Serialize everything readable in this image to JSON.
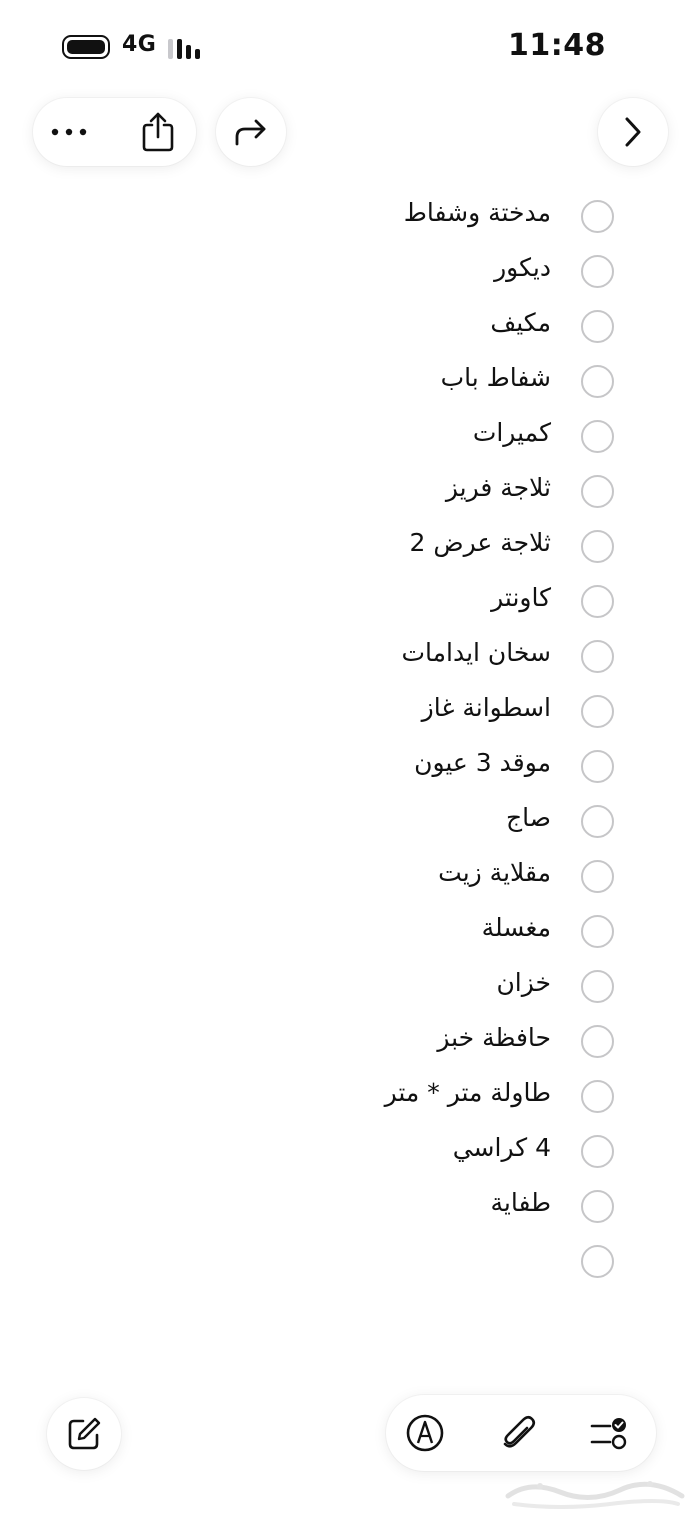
{
  "status_bar": {
    "network": "4G",
    "time": "11:48"
  },
  "toolbar_top": {
    "more_icon": "ellipsis-icon",
    "share_icon": "share-icon",
    "redo_icon": "redo-icon",
    "back_icon": "chevron-right-icon"
  },
  "checklist": {
    "items": [
      "مدختة وشفاط",
      "ديكور",
      "مكيف",
      "شفاط باب",
      "كميرات",
      "ثلاجة فريز",
      "ثلاجة عرض 2",
      "كاونتر",
      "سخان ايدامات",
      "اسطوانة غاز",
      "موقد 3 عيون",
      "صاج",
      "مقلاية زيت",
      "مغسلة",
      "خزان",
      "حافظة خبز",
      "طاولة متر * متر",
      "4 كراسي",
      "طفاية",
      ""
    ]
  },
  "toolbar_bottom": {
    "compose_icon": "compose-icon",
    "markup_icon": "markup-pen-icon",
    "attach_icon": "paperclip-icon",
    "checklist_icon": "checklist-icon"
  },
  "colors": {
    "circle_border": "#c6c6c8",
    "text": "#111111",
    "background": "#ffffff"
  }
}
